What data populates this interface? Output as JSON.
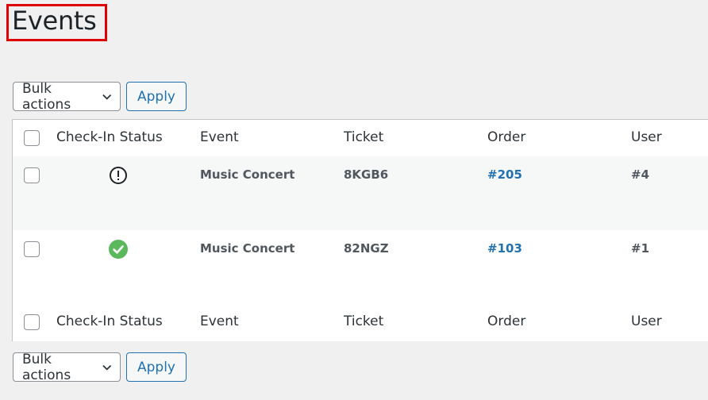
{
  "page": {
    "title": "Events"
  },
  "tablenav_top": {
    "bulk_label": "Bulk actions",
    "apply_label": "Apply"
  },
  "tablenav_bottom": {
    "bulk_label": "Bulk actions",
    "apply_label": "Apply"
  },
  "table": {
    "columns": [
      "Check-In Status",
      "Event",
      "Ticket",
      "Order",
      "User"
    ],
    "rows": [
      {
        "status_icon": "exclamation-circle-icon",
        "event": "Music Concert",
        "ticket": "8KGB6",
        "order": "#205",
        "user": "#4"
      },
      {
        "status_icon": "check-circle-icon",
        "event": "Music Concert",
        "ticket": "82NGZ",
        "order": "#103",
        "user": "#1"
      }
    ]
  },
  "colors": {
    "accent": "#2271b1",
    "checked_in": "#5cb85c",
    "highlight_box": "#e00000"
  }
}
